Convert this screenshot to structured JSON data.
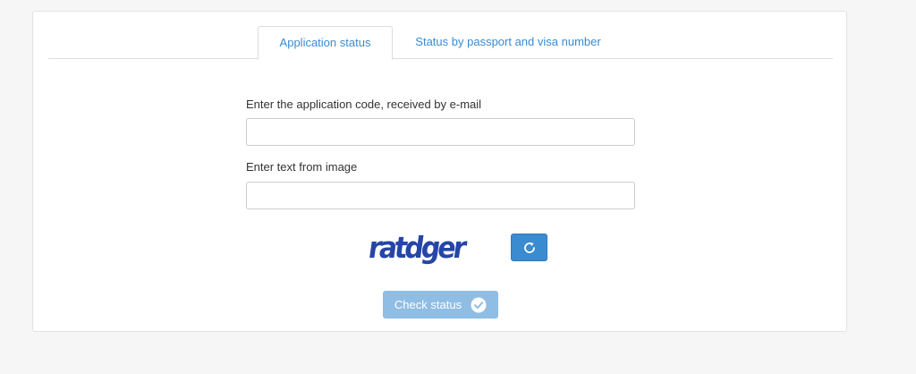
{
  "tabs": [
    {
      "label": "Application status",
      "active": true
    },
    {
      "label": "Status by passport and visa number",
      "active": false
    }
  ],
  "form": {
    "code_label": "Enter the application code, received by e-mail",
    "code_value": "",
    "captcha_label": "Enter text from image",
    "captcha_value": "",
    "captcha_text": "ratdger",
    "refresh_icon": "refresh-icon",
    "submit_label": "Check status",
    "submit_icon": "check-circle-icon"
  },
  "colors": {
    "accent": "#3a8bd0",
    "button_disabled": "#8fbde4",
    "captcha_ink": "#2545a8"
  }
}
